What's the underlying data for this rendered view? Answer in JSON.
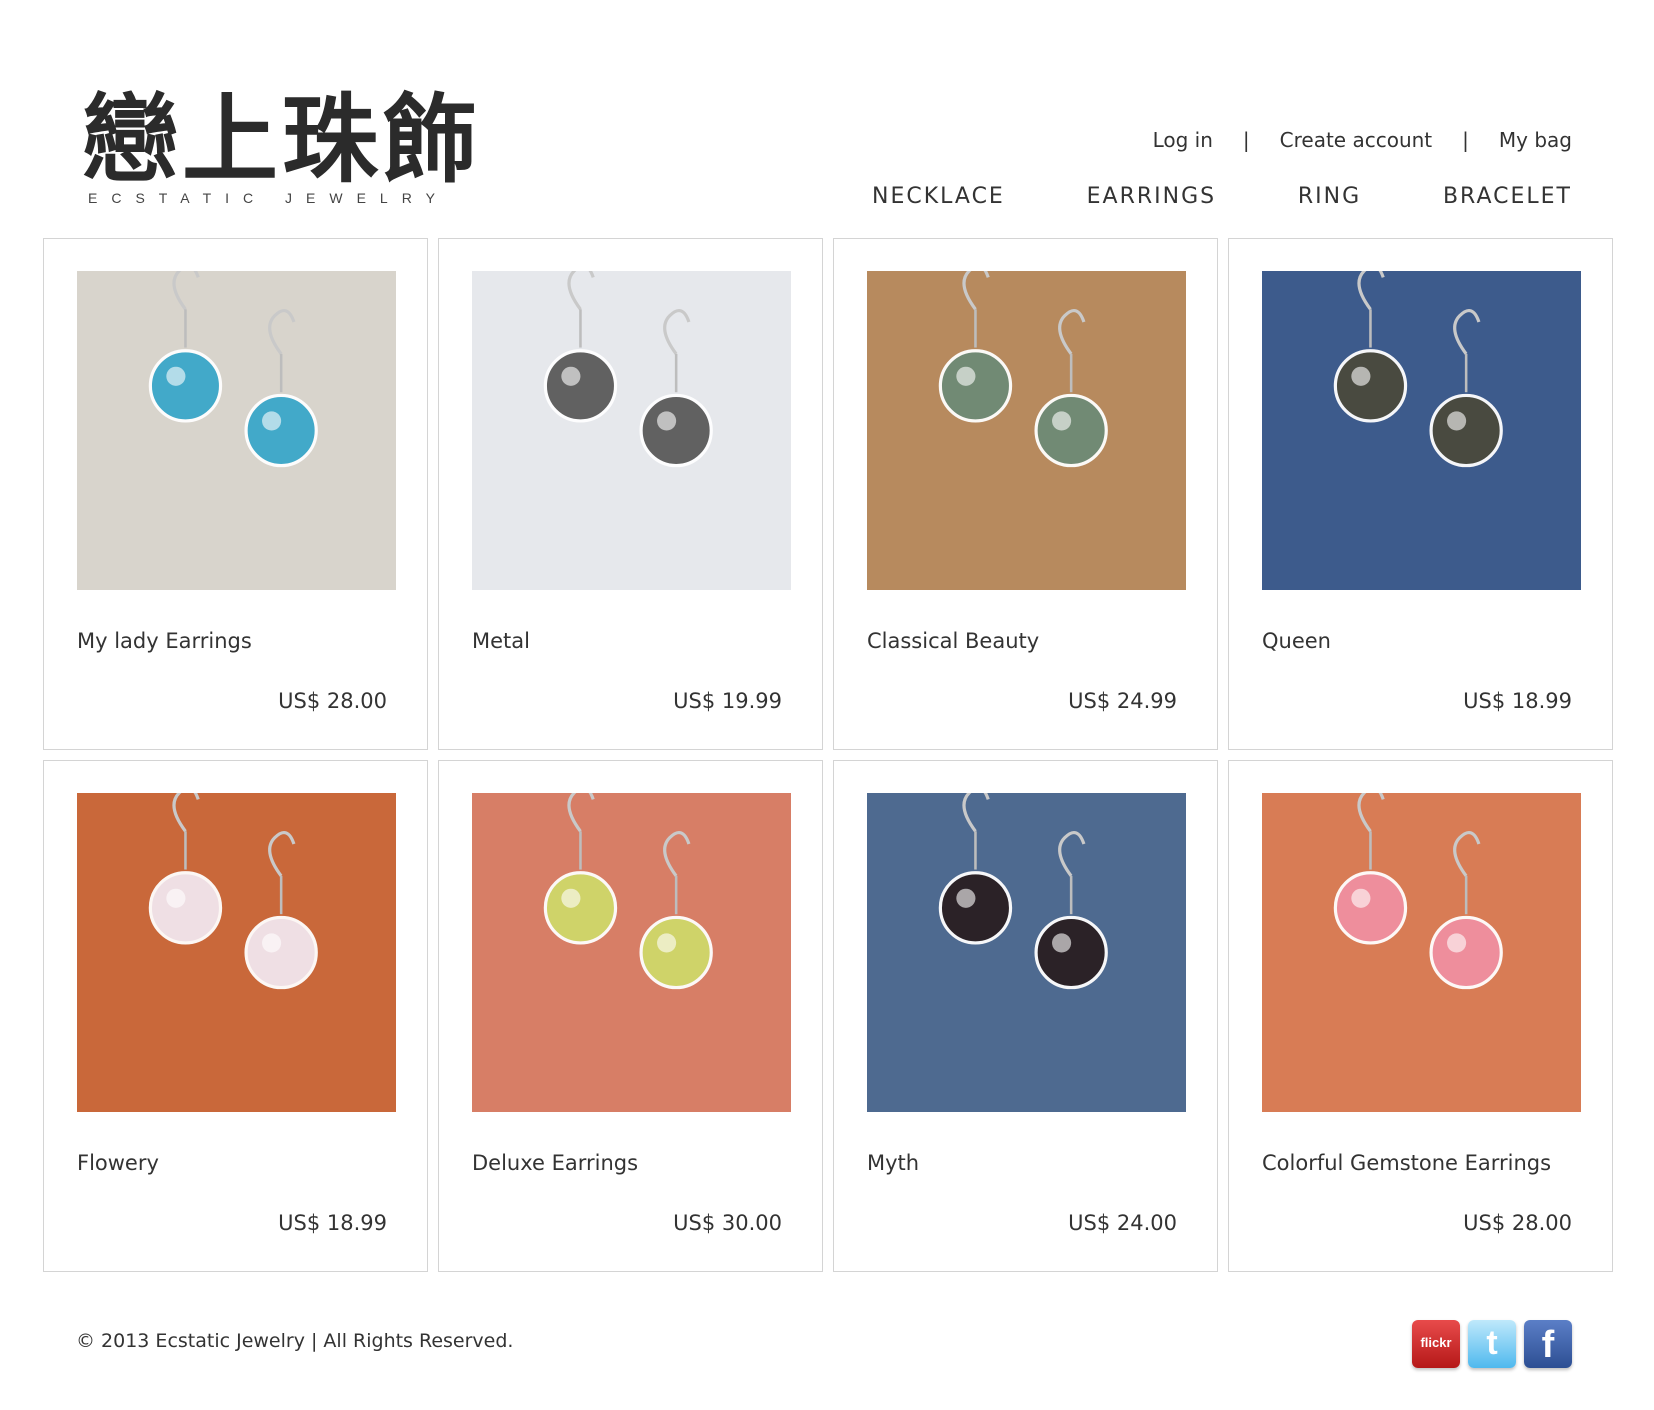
{
  "header": {
    "logo_cjk": "戀上珠飾",
    "logo_sub": "ECSTATIC JEWELRY",
    "account": {
      "login": "Log in",
      "sep": "|",
      "create": "Create account",
      "bag": "My bag"
    },
    "nav": [
      "NECKLACE",
      "EARRINGS",
      "RING",
      "BRACELET"
    ]
  },
  "products": [
    {
      "name": "My lady Earrings",
      "price": "US$ 28.00",
      "bg": "#d8d4cc",
      "accent": "#3aa7c9"
    },
    {
      "name": "Metal",
      "price": "US$ 19.99",
      "bg": "#e6e8ec",
      "accent": "#5a5a5a"
    },
    {
      "name": "Classical Beauty",
      "price": "US$ 24.99",
      "bg": "#b78a5e",
      "accent": "#6e8a76"
    },
    {
      "name": "Queen",
      "price": "US$ 18.99",
      "bg": "#3d5b8c",
      "accent": "#4a4a3c"
    },
    {
      "name": "Flowery",
      "price": "US$ 18.99",
      "bg": "#c9683a",
      "accent": "#f2e6ee"
    },
    {
      "name": "Deluxe Earrings",
      "price": "US$ 30.00",
      "bg": "#d77e66",
      "accent": "#cfd86a"
    },
    {
      "name": "Myth",
      "price": "US$ 24.00",
      "bg": "#4e6a90",
      "accent": "#2a1f22"
    },
    {
      "name": "Colorful Gemstone Earrings",
      "price": "US$ 28.00",
      "bg": "#d87c55",
      "accent": "#f08fa0"
    }
  ],
  "footer": {
    "copyright": "© 2013 Ecstatic Jewelry | All Rights Reserved.",
    "social": [
      "flickr",
      "t",
      "f"
    ]
  }
}
